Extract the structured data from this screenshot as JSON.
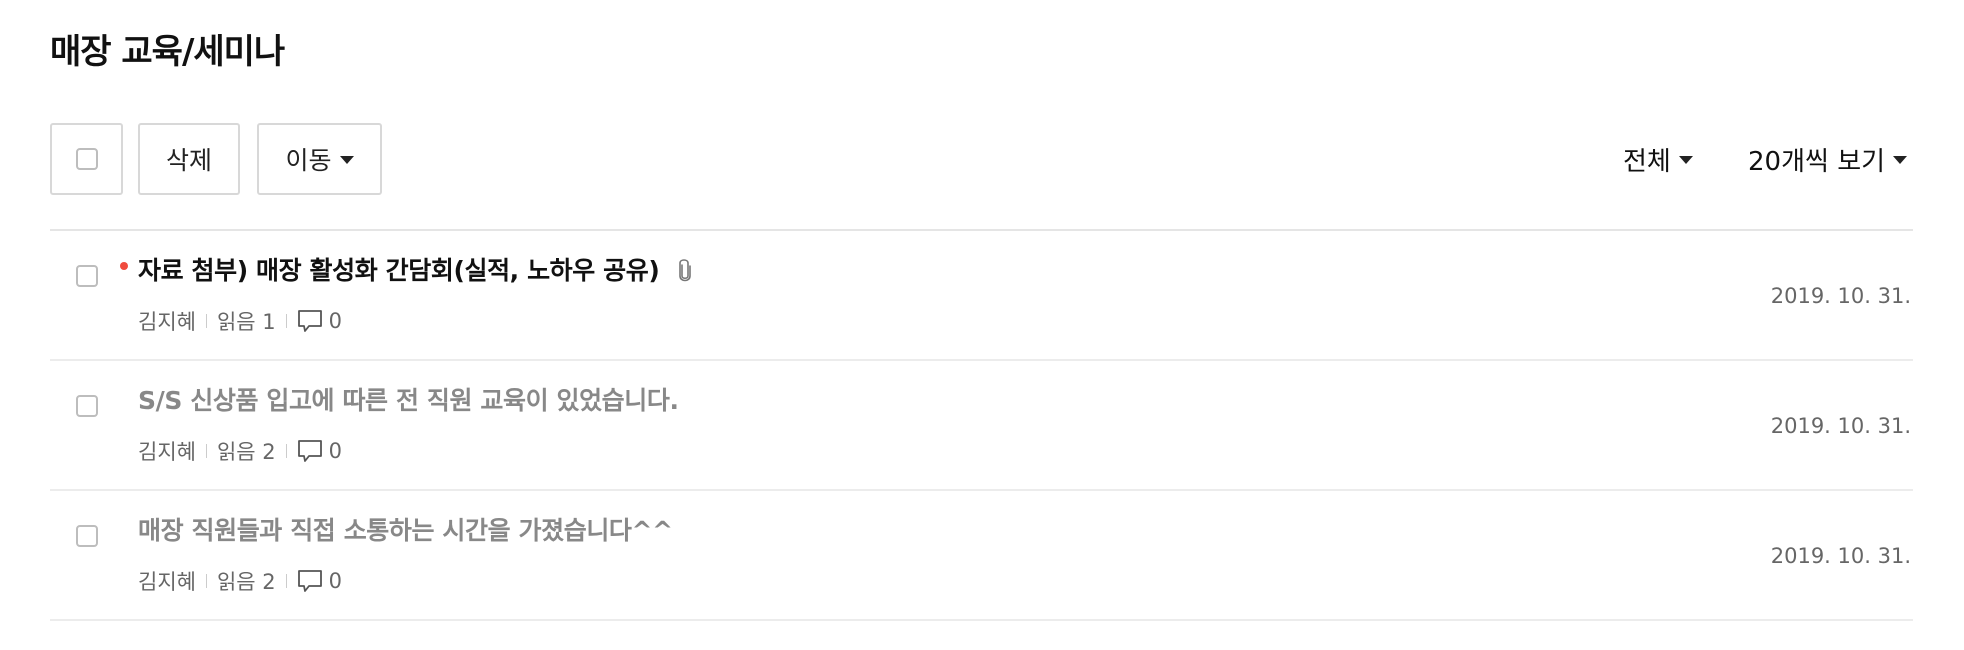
{
  "page": {
    "title": "매장 교육/세미나"
  },
  "toolbar": {
    "delete_label": "삭제",
    "move_label": "이동",
    "filter_label": "전체",
    "page_size_label": "20개씩 보기"
  },
  "posts": [
    {
      "title": "자료 첨부) 매장 활성화 간담회(실적, 노하우 공유)",
      "author": "김지혜",
      "reads": "읽음 1",
      "comments": "0",
      "date": "2019. 10. 31.",
      "is_new": true,
      "has_attachment": true
    },
    {
      "title": "S/S 신상품 입고에 따른 전 직원 교육이 있었습니다.",
      "author": "김지혜",
      "reads": "읽음 2",
      "comments": "0",
      "date": "2019. 10. 31.",
      "is_new": false,
      "has_attachment": false
    },
    {
      "title": "매장 직원들과 직접 소통하는 시간을 가졌습니다^^",
      "author": "김지혜",
      "reads": "읽음 2",
      "comments": "0",
      "date": "2019. 10. 31.",
      "is_new": false,
      "has_attachment": false
    }
  ],
  "icons": {
    "new_dot": "red-dot-icon",
    "attachment": "paperclip-icon",
    "comment": "speech-bubble-icon",
    "caret": "caret-down-icon",
    "checkbox": "checkbox-icon"
  },
  "colors": {
    "new_dot": "#f04b3e",
    "read_title": "#888888",
    "unread_title": "#111111",
    "border": "#d8d8d8"
  }
}
